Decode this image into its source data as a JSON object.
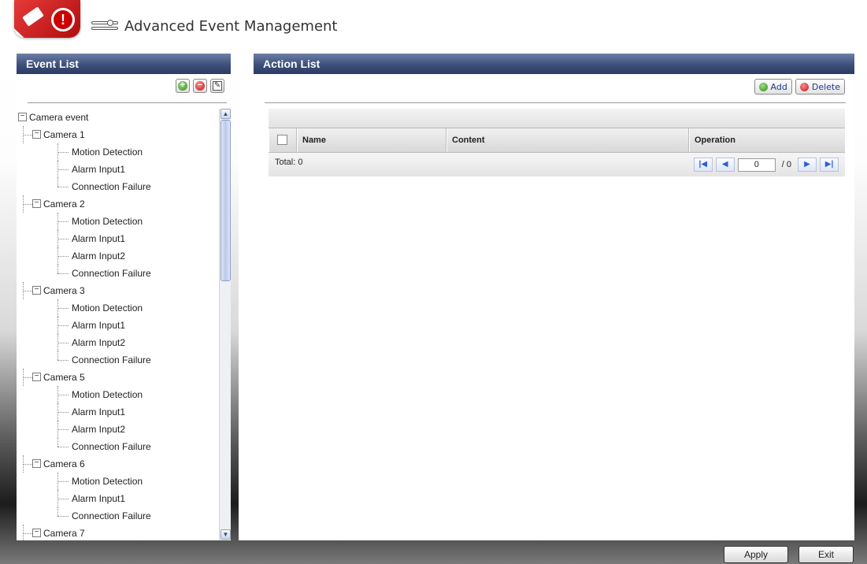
{
  "header": {
    "title": "Advanced Event Management",
    "alert_glyph": "!"
  },
  "event_list": {
    "title": "Event List",
    "toolbar": {
      "add_glyph": "+",
      "remove_glyph": "−",
      "edit_glyph": "✎"
    },
    "toggle_glyph": "−",
    "tree": {
      "root": "Camera event",
      "cameras": [
        {
          "name": "Camera 1",
          "events": [
            "Motion Detection",
            "Alarm Input1",
            "Connection Failure"
          ]
        },
        {
          "name": "Camera 2",
          "events": [
            "Motion Detection",
            "Alarm Input1",
            "Alarm Input2",
            "Connection Failure"
          ]
        },
        {
          "name": "Camera 3",
          "events": [
            "Motion Detection",
            "Alarm Input1",
            "Alarm Input2",
            "Connection Failure"
          ]
        },
        {
          "name": "Camera 5",
          "events": [
            "Motion Detection",
            "Alarm Input1",
            "Alarm Input2",
            "Connection Failure"
          ]
        },
        {
          "name": "Camera 6",
          "events": [
            "Motion Detection",
            "Alarm Input1",
            "Connection Failure"
          ]
        },
        {
          "name": "Camera 7",
          "events": []
        }
      ]
    }
  },
  "action_list": {
    "title": "Action List",
    "add_label": "Add",
    "delete_label": "Delete",
    "columns": {
      "name": "Name",
      "content": "Content",
      "operation": "Operation"
    },
    "total_label": "Total:  0",
    "pager": {
      "first": "|◀",
      "prev": "◀",
      "page_value": "0",
      "page_of": "/ 0",
      "next": "▶",
      "last": "▶|"
    }
  },
  "footer": {
    "apply_label": "Apply",
    "exit_label": "Exit"
  }
}
